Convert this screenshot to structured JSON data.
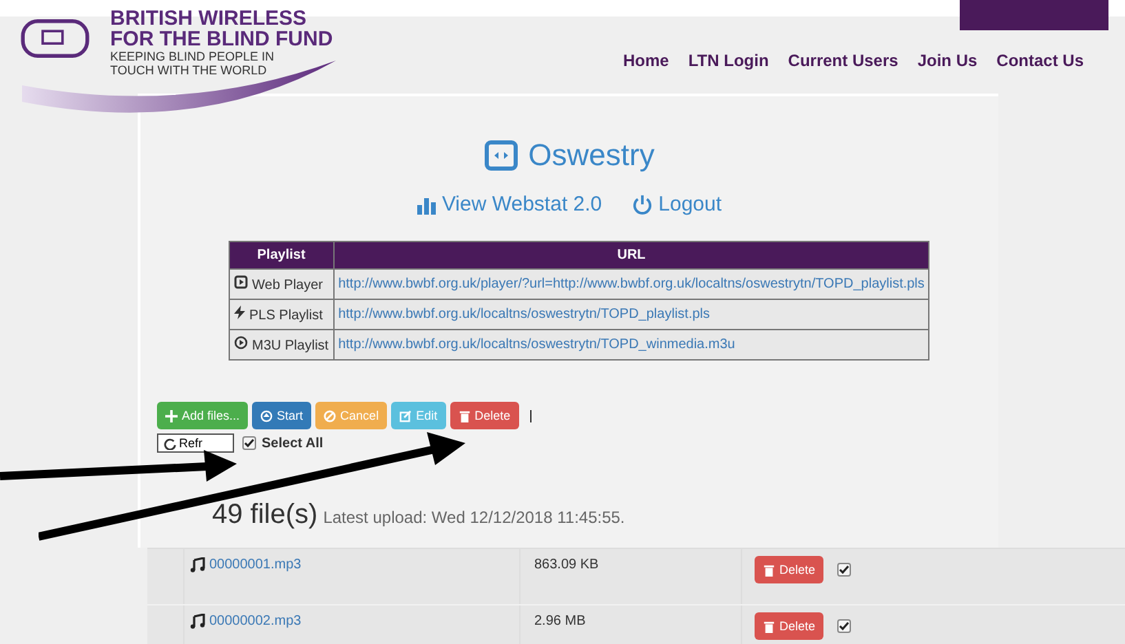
{
  "logo": {
    "name_line_1": "BRITISH WIRELESS",
    "name_line_2": "FOR THE BLIND FUND",
    "tagline_line_1": "KEEPING BLIND PEOPLE IN",
    "tagline_line_2": "TOUCH WITH THE WORLD"
  },
  "nav": [
    "Home",
    "LTN Login",
    "Current Users",
    "Join Us",
    "Contact Us"
  ],
  "station": {
    "title": "Oswestry"
  },
  "links": [
    {
      "kind": "stats",
      "label": "View Webstat 2.0"
    },
    {
      "kind": "logout",
      "label": "Logout"
    }
  ],
  "playlist_table": {
    "columns": [
      "Playlist",
      "URL"
    ],
    "rows": [
      {
        "kind": "player",
        "name": "Web Player",
        "url": "http://www.bwbf.org.uk/player/?url=http://www.bwbf.org.uk/localtns/oswestrytn/TOPD_playlist.pls"
      },
      {
        "kind": "pls",
        "name": "PLS Playlist",
        "url": "http://www.bwbf.org.uk/localtns/oswestrytn/TOPD_playlist.pls"
      },
      {
        "kind": "m3u",
        "name": "M3U Playlist",
        "url": "http://www.bwbf.org.uk/localtns/oswestrytn/TOPD_winmedia.m3u"
      }
    ]
  },
  "toolbar": [
    {
      "kind": "add",
      "label": "Add files..."
    },
    {
      "kind": "start",
      "label": "Start"
    },
    {
      "kind": "cancel",
      "label": "Cancel"
    },
    {
      "kind": "edit",
      "label": "Edit"
    },
    {
      "kind": "delete",
      "label": "Delete"
    }
  ],
  "refresh": {
    "label": "Refr"
  },
  "select_all": {
    "label": "Select All",
    "checked": true
  },
  "summary": {
    "count": "49 file(s)",
    "latest": "Latest upload: Wed 12/12/2018 11:45:55."
  },
  "files": [
    {
      "name": "00000001.mp3",
      "size": "863.09 KB",
      "delete": "Delete",
      "checked": true
    },
    {
      "name": "00000002.mp3",
      "size": "2.96 MB",
      "delete": "Delete",
      "checked": true
    }
  ]
}
